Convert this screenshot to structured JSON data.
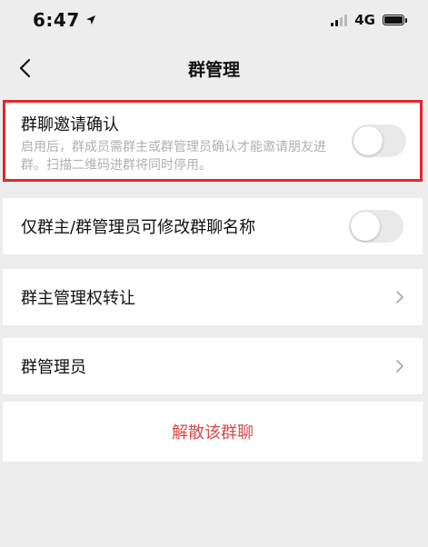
{
  "status_bar": {
    "time": "6:47",
    "network": "4G"
  },
  "nav": {
    "title": "群管理"
  },
  "invite_confirm": {
    "label": "群聊邀请确认",
    "description": "启用后，群成员需群主或群管理员确认才能邀请朋友进群。扫描二维码进群将同时停用。",
    "enabled": false
  },
  "rename_restrict": {
    "label": "仅群主/群管理员可修改群聊名称",
    "enabled": false
  },
  "transfer_owner": {
    "label": "群主管理权转让"
  },
  "group_admins": {
    "label": "群管理员"
  },
  "dissolve": {
    "label": "解散该群聊"
  },
  "colors": {
    "accent_red": "#e3262c",
    "dissolve_text": "#d44a4a",
    "background": "#ededed"
  }
}
